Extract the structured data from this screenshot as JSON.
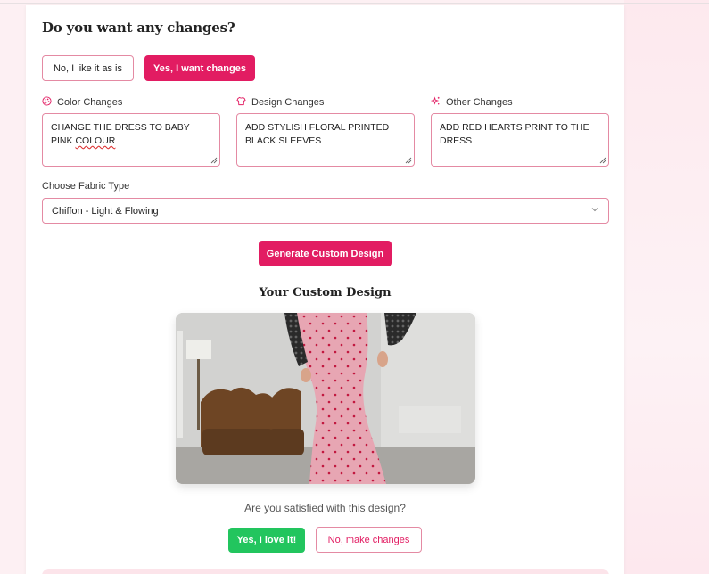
{
  "heading": "Do you want any changes?",
  "choice": {
    "no_label": "No, I like it as is",
    "yes_label": "Yes, I want changes"
  },
  "fields": {
    "color": {
      "label": "Color Changes",
      "value_line1": "CHANGE THE DRESS TO BABY",
      "value_pink": "PINK",
      "value_colour": "COLOUR"
    },
    "design": {
      "label": "Design Changes",
      "value": "ADD STYLISH  FLORAL PRINTED BLACK SLEEVES"
    },
    "other": {
      "label": "Other Changes",
      "value": "ADD RED HEARTS PRINT TO THE DRESS"
    }
  },
  "fabric": {
    "label": "Choose Fabric Type",
    "selected": "Chiffon - Light & Flowing"
  },
  "generate_label": "Generate Custom Design",
  "result": {
    "title": "Your Custom Design",
    "question": "Are you satisfied with this design?",
    "yes_label": "Yes, I love it!",
    "no_label": "No, make changes"
  },
  "colors": {
    "accent": "#e21c62",
    "border": "#e48aa3",
    "success": "#22c55e"
  },
  "icons": {
    "color": "palette-icon",
    "design": "shirt-icon",
    "other": "sparkles-icon",
    "select": "chevron-down-icon"
  }
}
